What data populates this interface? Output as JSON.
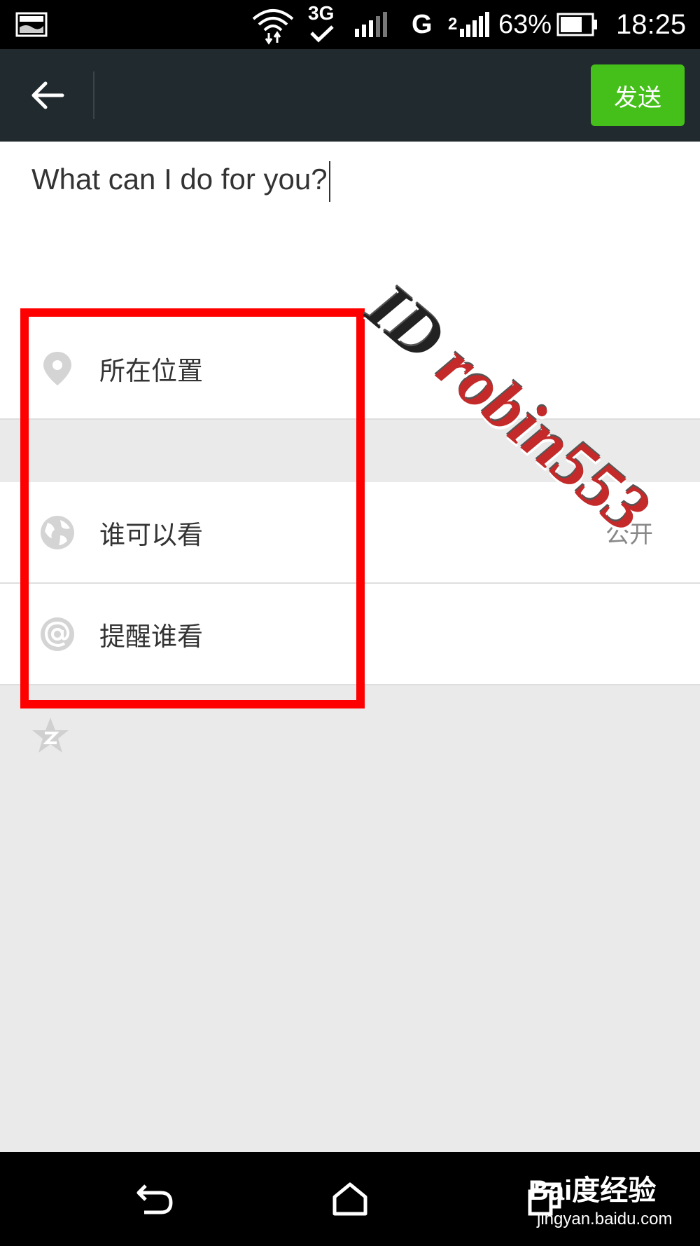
{
  "status_bar": {
    "network": "3G",
    "carrier_g": "G",
    "signal_2": "2",
    "battery": "63%",
    "time": "18:25"
  },
  "action_bar": {
    "send_label": "发送"
  },
  "compose": {
    "text": "What can I do for you?"
  },
  "options": {
    "location_label": "所在位置",
    "visibility_label": "谁可以看",
    "visibility_value": "公开",
    "mention_label": "提醒谁看"
  },
  "watermark": {
    "id": "ID",
    "name": "robin553"
  },
  "baidu": {
    "logo": "Bai度经验",
    "url": "jingyan.baidu.com"
  },
  "colors": {
    "accent": "#45c01a",
    "highlight": "#ff0000",
    "action_bar": "#212a2e"
  }
}
